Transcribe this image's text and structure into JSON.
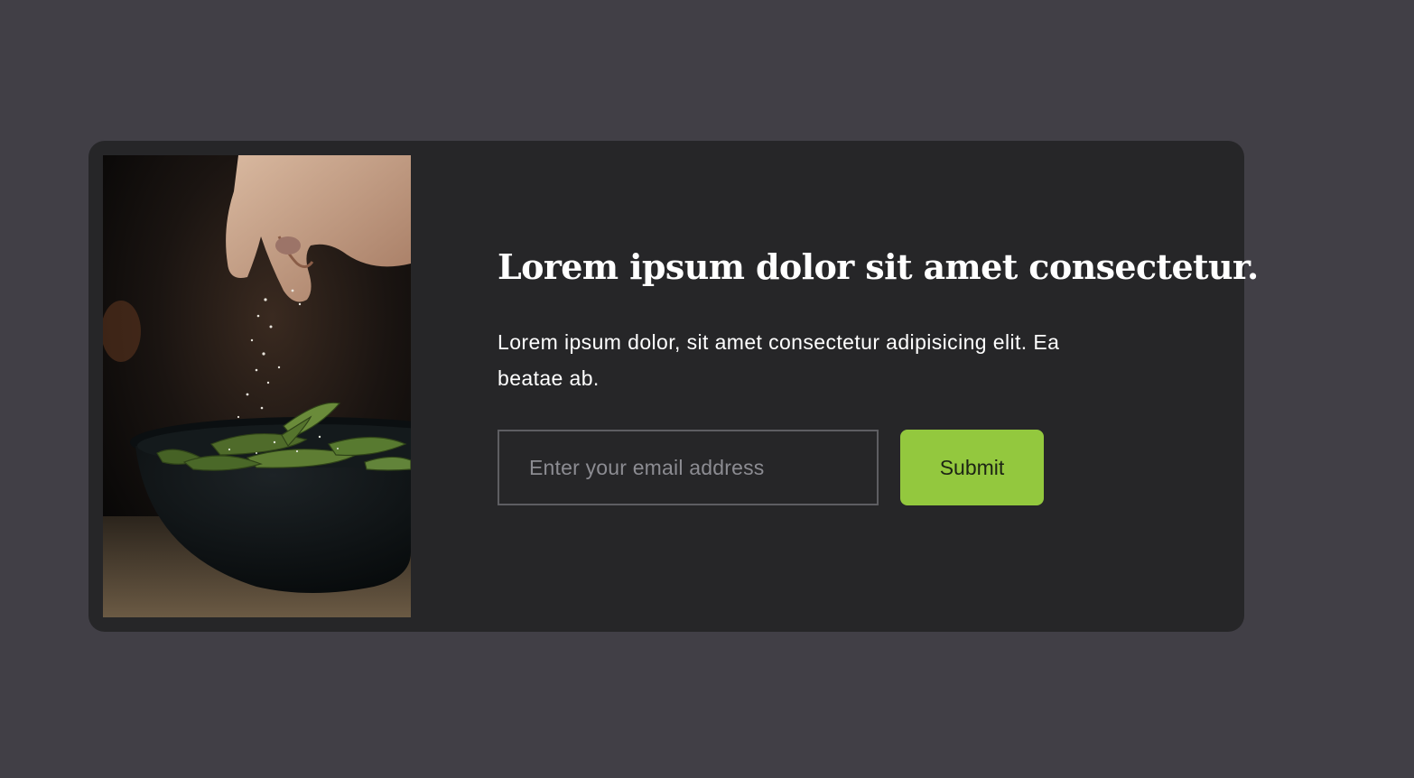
{
  "signup": {
    "title": "Lorem ipsum dolor sit amet consectetur.",
    "description": "Lorem ipsum dolor, sit amet consectetur adipisicing elit. Ea beatae ab.",
    "email_placeholder": "Enter your email address",
    "submit_label": "Submit"
  },
  "colors": {
    "page_background": "#413f46",
    "card_background": "#262628",
    "accent": "#93c83e"
  }
}
